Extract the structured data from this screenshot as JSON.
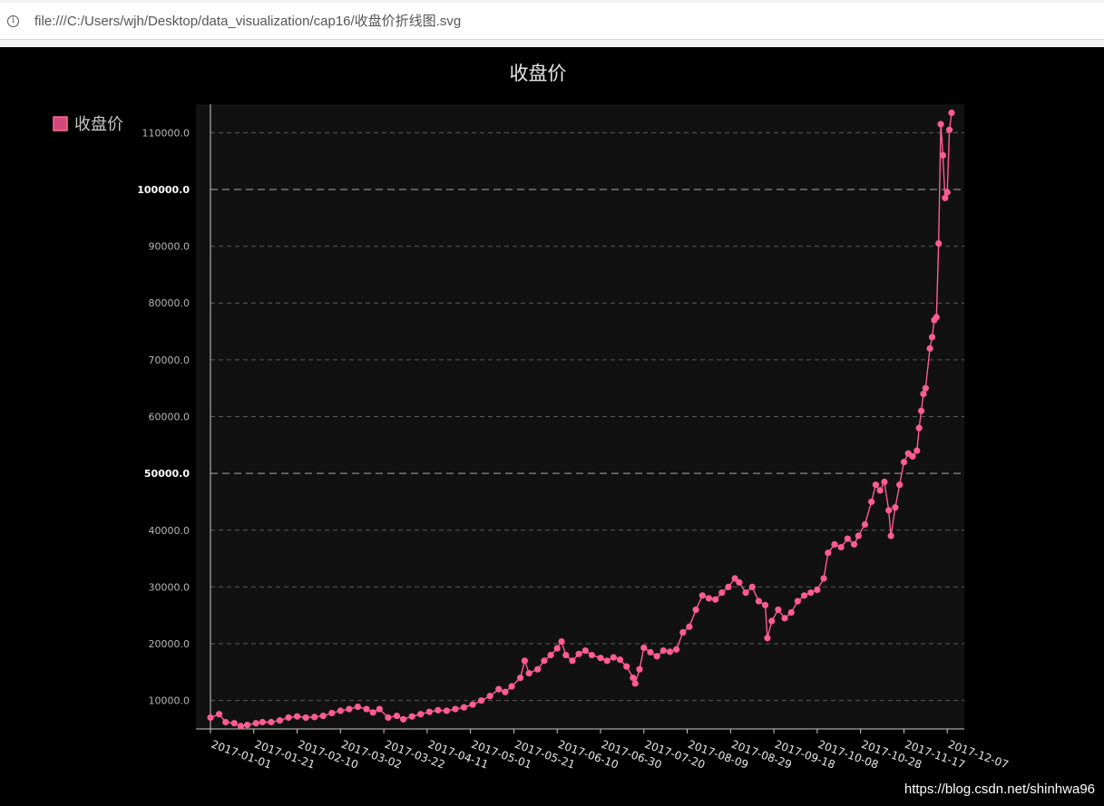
{
  "browser": {
    "url": "file:///C:/Users/wjh/Desktop/data_visualization/cap16/收盘价折线图.svg",
    "info_icon": "info-icon"
  },
  "watermark": "https://blog.csdn.net/shinhwa96",
  "chart_data": {
    "type": "line",
    "title": "收盘价",
    "legend": {
      "label": "收盘价",
      "position": "top-left",
      "color": "#d6487a"
    },
    "series": [
      {
        "name": "收盘价",
        "color": "#ff5c93",
        "points": [
          [
            "2017-01-01",
            7000
          ],
          [
            "2017-01-05",
            7600
          ],
          [
            "2017-01-08",
            6200
          ],
          [
            "2017-01-12",
            6000
          ],
          [
            "2017-01-15",
            5500
          ],
          [
            "2017-01-18",
            5700
          ],
          [
            "2017-01-22",
            6000
          ],
          [
            "2017-01-25",
            6200
          ],
          [
            "2017-01-29",
            6200
          ],
          [
            "2017-02-02",
            6500
          ],
          [
            "2017-02-06",
            7000
          ],
          [
            "2017-02-10",
            7200
          ],
          [
            "2017-02-14",
            7000
          ],
          [
            "2017-02-18",
            7100
          ],
          [
            "2017-02-22",
            7300
          ],
          [
            "2017-02-26",
            7800
          ],
          [
            "2017-03-02",
            8200
          ],
          [
            "2017-03-06",
            8500
          ],
          [
            "2017-03-10",
            8900
          ],
          [
            "2017-03-14",
            8500
          ],
          [
            "2017-03-17",
            7900
          ],
          [
            "2017-03-20",
            8500
          ],
          [
            "2017-03-24",
            7000
          ],
          [
            "2017-03-28",
            7300
          ],
          [
            "2017-03-31",
            6700
          ],
          [
            "2017-04-04",
            7200
          ],
          [
            "2017-04-08",
            7600
          ],
          [
            "2017-04-12",
            8000
          ],
          [
            "2017-04-16",
            8300
          ],
          [
            "2017-04-20",
            8200
          ],
          [
            "2017-04-24",
            8500
          ],
          [
            "2017-04-28",
            8800
          ],
          [
            "2017-05-02",
            9300
          ],
          [
            "2017-05-06",
            10000
          ],
          [
            "2017-05-10",
            10800
          ],
          [
            "2017-05-14",
            12000
          ],
          [
            "2017-05-17",
            11500
          ],
          [
            "2017-05-20",
            12500
          ],
          [
            "2017-05-24",
            14000
          ],
          [
            "2017-05-26",
            17000
          ],
          [
            "2017-05-28",
            14800
          ],
          [
            "2017-06-01",
            15500
          ],
          [
            "2017-06-04",
            17000
          ],
          [
            "2017-06-07",
            18000
          ],
          [
            "2017-06-10",
            19200
          ],
          [
            "2017-06-12",
            20400
          ],
          [
            "2017-06-14",
            18000
          ],
          [
            "2017-06-17",
            17000
          ],
          [
            "2017-06-20",
            18200
          ],
          [
            "2017-06-23",
            18800
          ],
          [
            "2017-06-26",
            18000
          ],
          [
            "2017-06-30",
            17500
          ],
          [
            "2017-07-03",
            17000
          ],
          [
            "2017-07-06",
            17600
          ],
          [
            "2017-07-09",
            17200
          ],
          [
            "2017-07-12",
            16000
          ],
          [
            "2017-07-15",
            14000
          ],
          [
            "2017-07-16",
            13000
          ],
          [
            "2017-07-18",
            15500
          ],
          [
            "2017-07-20",
            19300
          ],
          [
            "2017-07-23",
            18500
          ],
          [
            "2017-07-26",
            17800
          ],
          [
            "2017-07-29",
            18800
          ],
          [
            "2017-08-01",
            18600
          ],
          [
            "2017-08-04",
            19000
          ],
          [
            "2017-08-07",
            22000
          ],
          [
            "2017-08-10",
            23000
          ],
          [
            "2017-08-13",
            26000
          ],
          [
            "2017-08-16",
            28500
          ],
          [
            "2017-08-19",
            28000
          ],
          [
            "2017-08-22",
            27800
          ],
          [
            "2017-08-25",
            29000
          ],
          [
            "2017-08-28",
            30000
          ],
          [
            "2017-08-31",
            31500
          ],
          [
            "2017-09-02",
            30800
          ],
          [
            "2017-09-05",
            29000
          ],
          [
            "2017-09-08",
            30000
          ],
          [
            "2017-09-11",
            27500
          ],
          [
            "2017-09-14",
            26800
          ],
          [
            "2017-09-15",
            21000
          ],
          [
            "2017-09-17",
            24000
          ],
          [
            "2017-09-20",
            26000
          ],
          [
            "2017-09-23",
            24500
          ],
          [
            "2017-09-26",
            25500
          ],
          [
            "2017-09-29",
            27500
          ],
          [
            "2017-10-02",
            28500
          ],
          [
            "2017-10-05",
            29000
          ],
          [
            "2017-10-08",
            29500
          ],
          [
            "2017-10-11",
            31500
          ],
          [
            "2017-10-13",
            36000
          ],
          [
            "2017-10-16",
            37500
          ],
          [
            "2017-10-19",
            37000
          ],
          [
            "2017-10-22",
            38500
          ],
          [
            "2017-10-25",
            37500
          ],
          [
            "2017-10-27",
            39000
          ],
          [
            "2017-10-30",
            41000
          ],
          [
            "2017-11-02",
            45000
          ],
          [
            "2017-11-04",
            48000
          ],
          [
            "2017-11-06",
            47000
          ],
          [
            "2017-11-08",
            48500
          ],
          [
            "2017-11-10",
            43500
          ],
          [
            "2017-11-11",
            39000
          ],
          [
            "2017-11-13",
            44000
          ],
          [
            "2017-11-15",
            48000
          ],
          [
            "2017-11-17",
            52000
          ],
          [
            "2017-11-19",
            53500
          ],
          [
            "2017-11-21",
            53000
          ],
          [
            "2017-11-23",
            54000
          ],
          [
            "2017-11-24",
            58000
          ],
          [
            "2017-11-25",
            61000
          ],
          [
            "2017-11-26",
            64000
          ],
          [
            "2017-11-27",
            65000
          ],
          [
            "2017-11-29",
            72000
          ],
          [
            "2017-11-30",
            74000
          ],
          [
            "2017-12-01",
            77000
          ],
          [
            "2017-12-02",
            77500
          ],
          [
            "2017-12-03",
            90500
          ],
          [
            "2017-12-04",
            111500
          ],
          [
            "2017-12-05",
            106000
          ],
          [
            "2017-12-06",
            98500
          ],
          [
            "2017-12-07",
            99500
          ],
          [
            "2017-12-08",
            110500
          ],
          [
            "2017-12-09",
            113500
          ]
        ]
      }
    ],
    "x_axis": {
      "type": "date",
      "range": [
        "2017-01-01",
        "2017-12-09"
      ],
      "tick_labels": [
        "2017-01-01",
        "2017-01-21",
        "2017-02-10",
        "2017-03-02",
        "2017-03-22",
        "2017-04-11",
        "2017-05-01",
        "2017-05-21",
        "2017-06-10",
        "2017-06-30",
        "2017-07-20",
        "2017-08-09",
        "2017-08-29",
        "2017-09-18",
        "2017-10-08",
        "2017-10-28",
        "2017-11-17",
        "2017-12-07"
      ]
    },
    "y_axis": {
      "range": [
        5000,
        115000
      ],
      "ticks": [
        10000,
        20000,
        30000,
        40000,
        50000,
        60000,
        70000,
        80000,
        90000,
        100000,
        110000
      ],
      "tick_labels": [
        "10000.0",
        "20000.0",
        "30000.0",
        "40000.0",
        "50000.0",
        "60000.0",
        "70000.0",
        "80000.0",
        "90000.0",
        "100000.0",
        "110000.0"
      ],
      "major_ticks": [
        50000,
        100000
      ]
    },
    "grid": true
  }
}
